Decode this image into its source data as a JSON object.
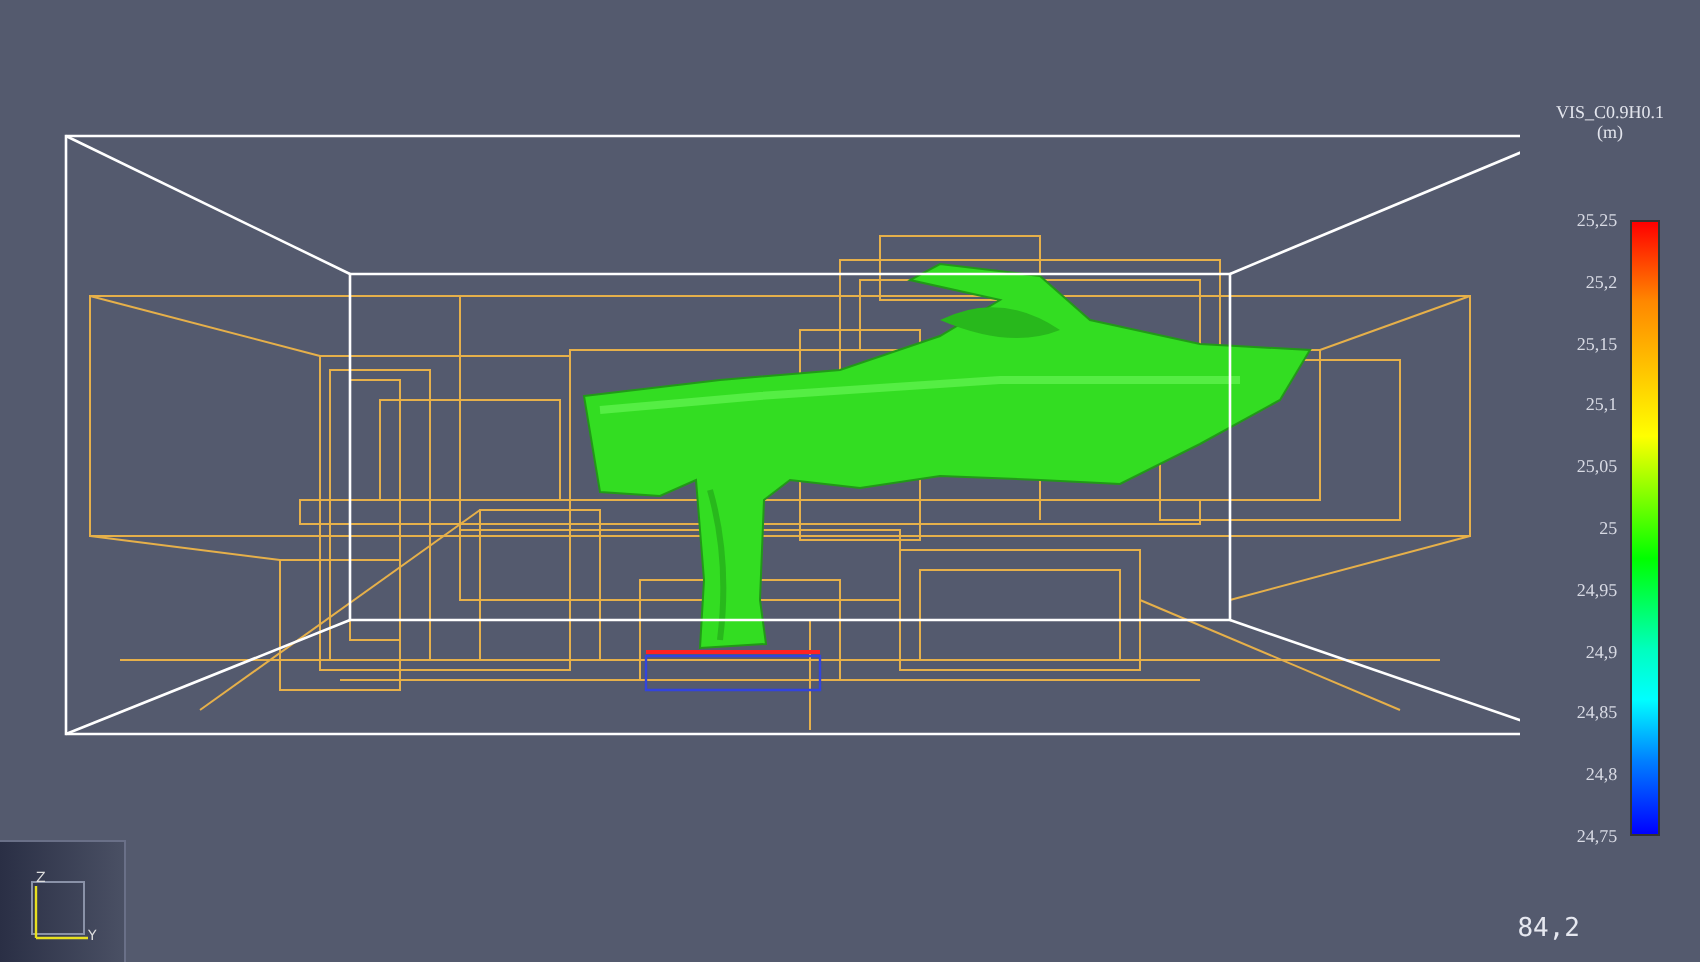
{
  "legend": {
    "title": "VIS_C0.9H0.1",
    "unit": "(m)",
    "ticks": [
      "25,25",
      "25,2",
      "25,15",
      "25,1",
      "25,05",
      "25",
      "24,95",
      "24,9",
      "24,85",
      "24,8",
      "24,75"
    ]
  },
  "axis_widget": {
    "labels": [
      "Z",
      "Y"
    ]
  },
  "time": "84,2"
}
